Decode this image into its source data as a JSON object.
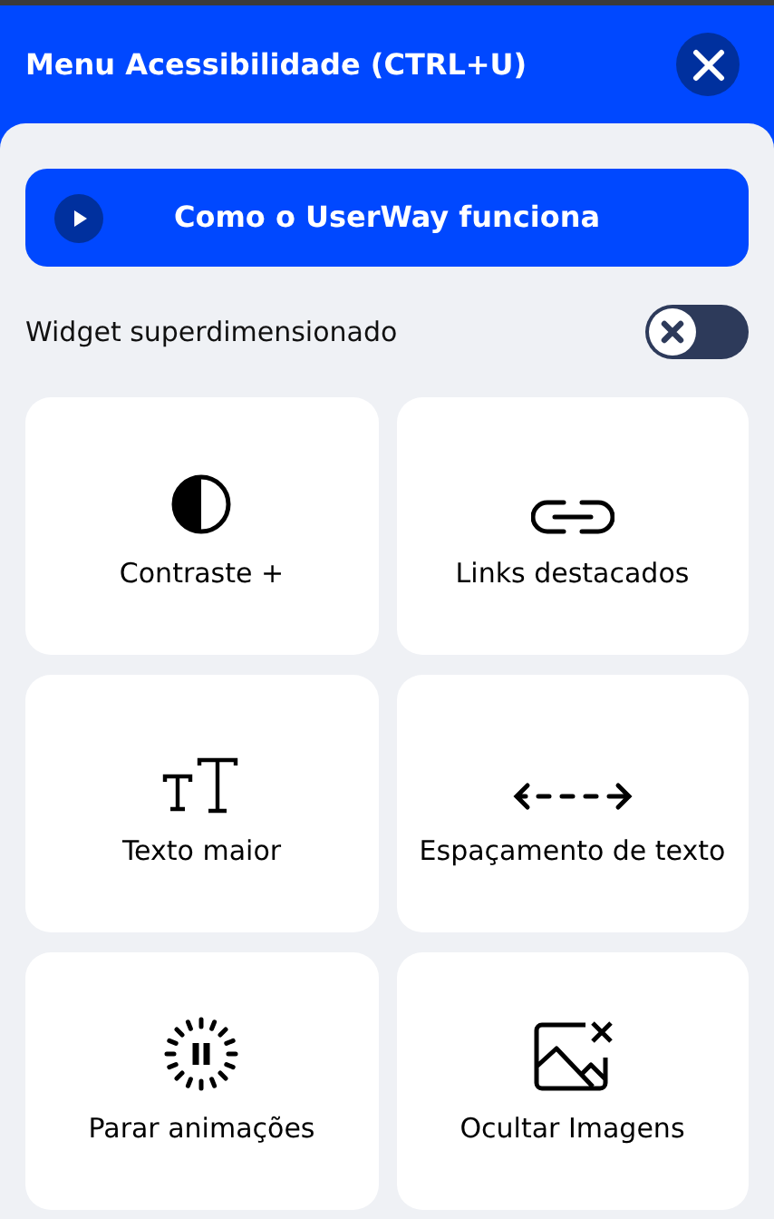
{
  "header": {
    "title": "Menu Acessibilidade (CTRL+U)"
  },
  "video_button": {
    "label": "Como o UserWay funciona"
  },
  "toggle": {
    "label": "Widget superdimensionado",
    "on": false
  },
  "features": [
    {
      "kind": "contrast",
      "label": "Contraste +"
    },
    {
      "kind": "links",
      "label": "Links destacados"
    },
    {
      "kind": "bigtext",
      "label": "Texto maior"
    },
    {
      "kind": "spacing",
      "label": "Espaçamento de texto"
    },
    {
      "kind": "pause",
      "label": "Parar animações"
    },
    {
      "kind": "images",
      "label": "Ocultar Imagens"
    }
  ]
}
